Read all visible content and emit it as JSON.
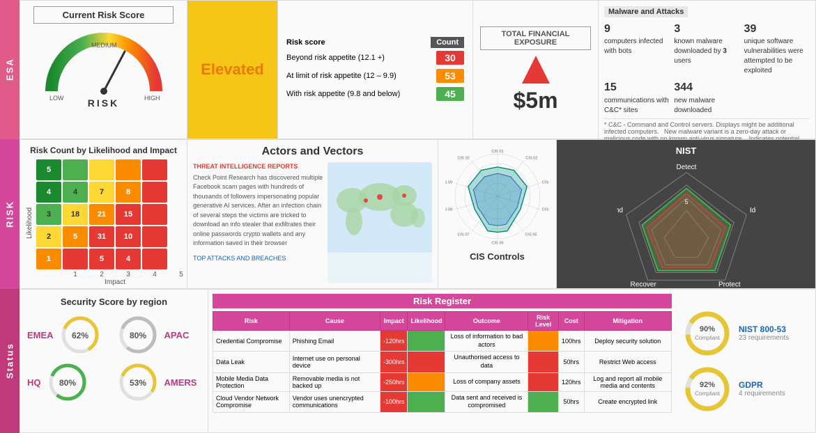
{
  "esa": {
    "label": "ESA",
    "risk_score_title": "Current Risk Score",
    "gauge_level": "MEDIUM",
    "gauge_label": "RISK",
    "elevated": "Elevated",
    "table": {
      "col1": "Risk score",
      "col2": "Count",
      "rows": [
        {
          "label": "Beyond risk appetite (12.1 +)",
          "count": "30",
          "color": "red"
        },
        {
          "label": "At limit of risk appetite (12 – 9.9)",
          "count": "53",
          "color": "orange"
        },
        {
          "label": "With risk appetite (9.8 and below)",
          "count": "45",
          "color": "green"
        }
      ]
    },
    "financial": {
      "label": "TOTAL FINANCIAL EXPOSURE",
      "amount": "$5m"
    },
    "malware": {
      "section_title": "Malware and Attacks",
      "items": [
        {
          "num": "9",
          "desc": "computers infected with bots"
        },
        {
          "num": "3",
          "desc": "known malware downloaded by 3 users"
        },
        {
          "num": "39",
          "desc": "unique software vulnerabilities were attempted to be exploited"
        }
      ],
      "items2": [
        {
          "num": "15",
          "desc": "communications with C&C* sites"
        },
        {
          "num": "344",
          "desc": "new malware downloaded"
        }
      ],
      "note1": "* C&C - Command and Control servers. Displays might be additional infected computers.",
      "note2": "New malware variant is a zero-day attack or malicious code with no known anti-virus signature.",
      "note3": "Indicates potential attacks on computers on your network."
    }
  },
  "risk": {
    "label": "RISK",
    "heatmap": {
      "title": "Risk Count by Likelihood and Impact",
      "y_axis_label": "Likelihood",
      "x_axis_label": "Impact",
      "x_labels": [
        "1",
        "2",
        "3",
        "4",
        "5"
      ],
      "y_labels": [
        "5",
        "4",
        "3",
        "2",
        "1"
      ],
      "cells": [
        [
          null,
          null,
          null,
          null,
          null
        ],
        [
          null,
          "4",
          "7",
          "8",
          null
        ],
        [
          null,
          "18",
          "21",
          "15",
          null
        ],
        [
          null,
          "5",
          "31",
          "10",
          null
        ],
        [
          null,
          null,
          "5",
          "4",
          null
        ]
      ],
      "colors": [
        [
          "green-dark",
          "green-dark",
          "green-dark",
          "yellow",
          "orange"
        ],
        [
          "green-dark",
          "green",
          "yellow",
          "orange",
          "red"
        ],
        [
          "green",
          "yellow",
          "orange",
          "red",
          "red"
        ],
        [
          "yellow",
          "orange",
          "red",
          "red",
          "red"
        ],
        [
          "orange",
          "red",
          "red",
          "red",
          "red"
        ]
      ]
    },
    "actors": {
      "title": "Actors and Vectors",
      "threat_label": "THREAT INTELLIGENCE REPORTS",
      "text": "Check Point Research has discovered multiple Facebook scam pages with hundreds of thousands of followers impersonating popular generative AI services. After an infection chain of several steps the victims are tricked to download an info stealer that exfiltrates their online passwords crypto wallets and any information saved in their browser",
      "link": "TOP ATTACKS AND BREACHES"
    },
    "cis": {
      "title": "CIS Controls"
    },
    "nist": {
      "title": "NIST",
      "labels": [
        "Detect",
        "Identify",
        "Protect",
        "Recover",
        "Respond"
      ],
      "score": 5
    }
  },
  "status": {
    "label": "Status",
    "security_score": {
      "title": "Security Score by region",
      "regions": [
        {
          "name": "EMEA",
          "value": 62,
          "color": "#e8c535"
        },
        {
          "name": "APAC",
          "value": 80,
          "color": "#bdbdbd"
        },
        {
          "name": "HQ",
          "value": 80,
          "color": "#4caf50"
        },
        {
          "name": "AMERS",
          "value": 53,
          "color": "#e8c535"
        }
      ]
    },
    "risk_register": {
      "title": "Risk Register",
      "headers": [
        "Risk",
        "Cause",
        "Impact",
        "Likelihood",
        "Outcome",
        "Risk Level",
        "Cost",
        "Mitigation"
      ],
      "rows": [
        {
          "risk": "Credential Compromise",
          "cause": "Phishing Email",
          "impact": "-120hrs",
          "likelihood": "",
          "outcome": "Loss of information to bad actors",
          "risk_level": "orange",
          "cost": "100hrs",
          "mitigation": "Deploy security solution",
          "impact_color": "red",
          "likelihood_color": "green"
        },
        {
          "risk": "Data Leak",
          "cause": "Internet use on personal device",
          "impact": "-300hrs",
          "likelihood": "",
          "outcome": "Unauthorised access to data",
          "risk_level": "red",
          "cost": "50hrs",
          "mitigation": "Restrict Web access",
          "impact_color": "red",
          "likelihood_color": "red"
        },
        {
          "risk": "Mobile Media Data Protection",
          "cause": "Removable media is not backed up",
          "impact": "-250hrs",
          "likelihood": "",
          "outcome": "Loss of company assets",
          "risk_level": "red",
          "cost": "120hrs",
          "mitigation": "Log and report all mobile media and contents",
          "impact_color": "red",
          "likelihood_color": "orange"
        },
        {
          "risk": "Cloud Vendor Network Compromise",
          "cause": "Vendor uses unencrypted communications",
          "impact": "-100hrs",
          "likelihood": "",
          "outcome": "Data sent and received is compromised",
          "risk_level": "green",
          "cost": "50hrs",
          "mitigation": "Create encrypted link",
          "impact_color": "red",
          "likelihood_color": "green"
        }
      ]
    },
    "compliance": [
      {
        "pct": "90%",
        "label": "Compliant",
        "name": "NIST 800-53",
        "req": "23 requirements",
        "color": "#e8c535"
      },
      {
        "pct": "92%",
        "label": "Compliant",
        "name": "GDPR",
        "req": "4 requirements",
        "color": "#e8c535"
      }
    ]
  }
}
